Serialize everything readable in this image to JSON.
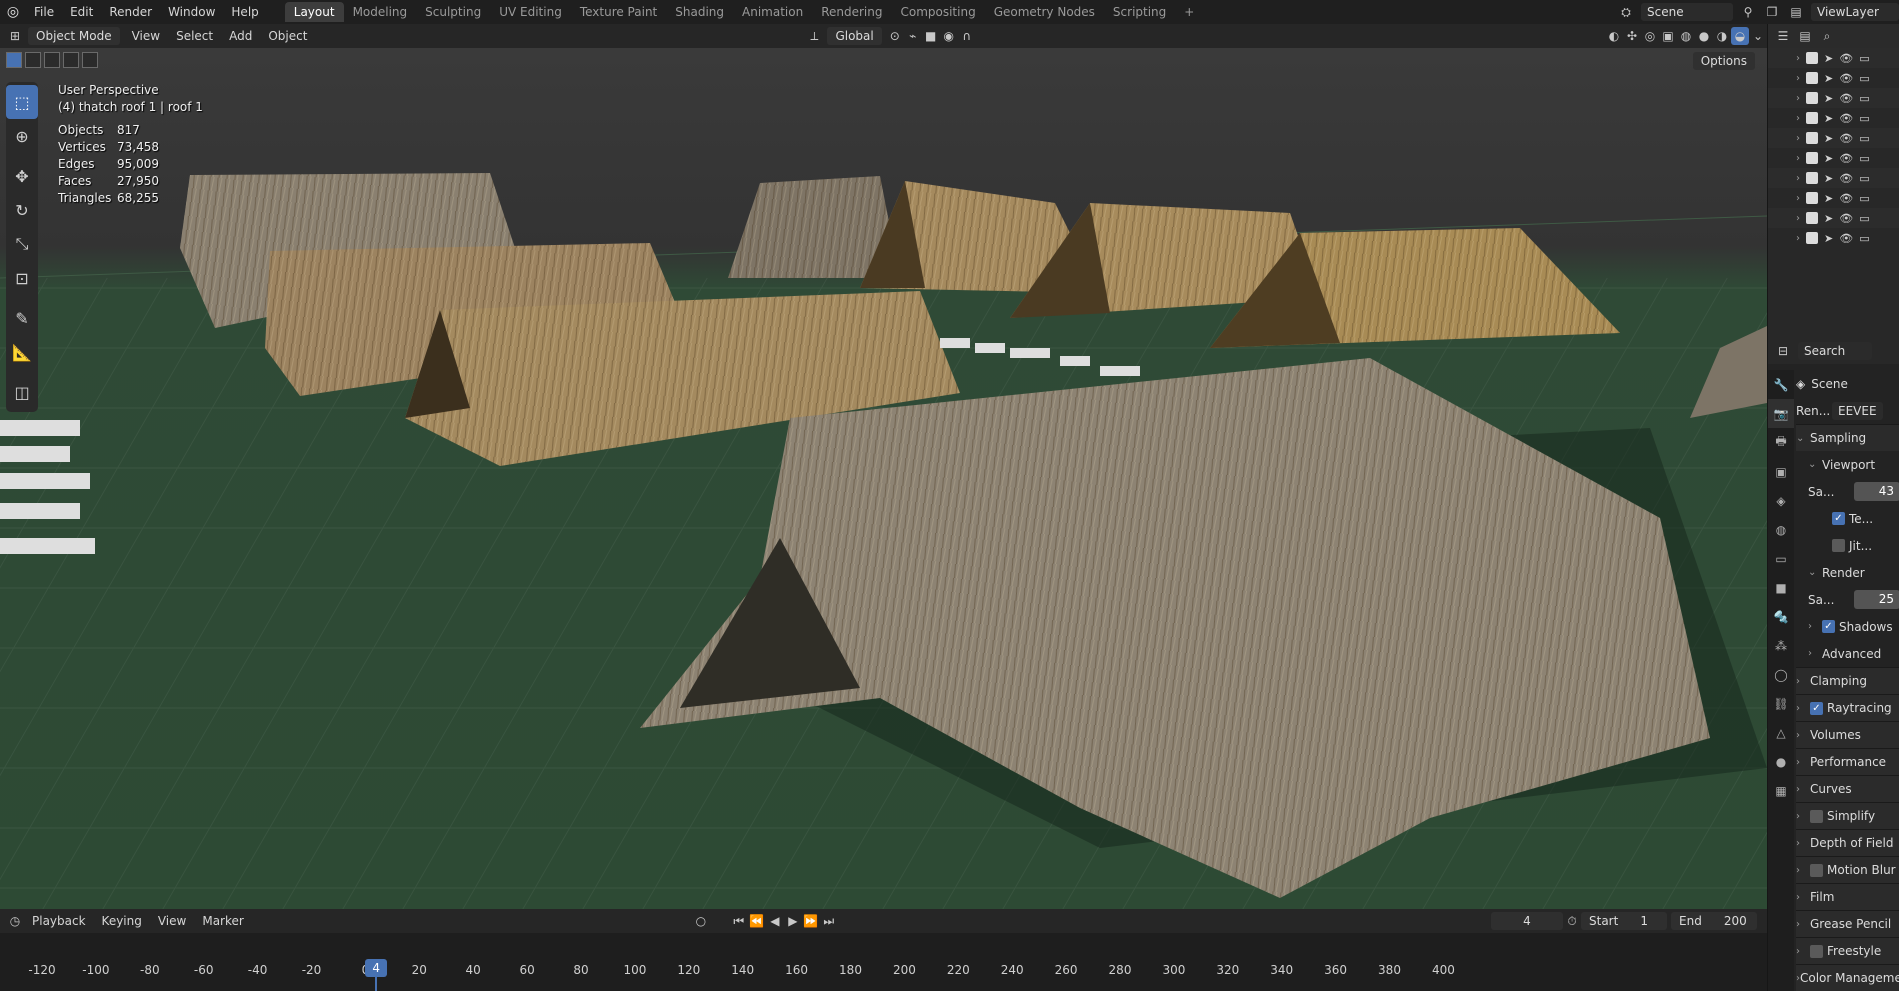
{
  "menu": {
    "items": [
      "File",
      "Edit",
      "Render",
      "Window",
      "Help"
    ],
    "workspaces": [
      "Layout",
      "Modeling",
      "Sculpting",
      "UV Editing",
      "Texture Paint",
      "Shading",
      "Animation",
      "Rendering",
      "Compositing",
      "Geometry Nodes",
      "Scripting"
    ],
    "active_workspace": "Layout",
    "add_tab": "+",
    "scene": "Scene",
    "view_layer": "ViewLayer"
  },
  "viewport_header": {
    "mode": "Object Mode",
    "menus": [
      "View",
      "Select",
      "Add",
      "Object"
    ],
    "orientation": "Global",
    "options": "Options"
  },
  "overlay": {
    "perspective": "User Perspective",
    "context": "(4) thatch roof 1 | roof 1",
    "stats": [
      {
        "label": "Objects",
        "value": "817"
      },
      {
        "label": "Vertices",
        "value": "73,458"
      },
      {
        "label": "Edges",
        "value": "95,009"
      },
      {
        "label": "Faces",
        "value": "27,950"
      },
      {
        "label": "Triangles",
        "value": "68,255"
      }
    ]
  },
  "toolbar": {
    "tools": [
      "select-box-tool",
      "cursor-tool",
      "move-tool",
      "rotate-tool",
      "scale-tool",
      "transform-tool",
      "annotate-tool",
      "measure-tool",
      "add-cube-tool"
    ]
  },
  "timeline": {
    "menus": [
      "Playback",
      "Keying",
      "View",
      "Marker"
    ],
    "current_frame": "4",
    "start_label": "Start",
    "start": "1",
    "end_label": "End",
    "end": "200",
    "ticks": [
      "-120",
      "-100",
      "-80",
      "-60",
      "-40",
      "-20",
      "0",
      "20",
      "40",
      "60",
      "80",
      "100",
      "120",
      "140",
      "160",
      "180",
      "200",
      "220",
      "240",
      "260",
      "280",
      "300",
      "320",
      "340",
      "360",
      "380",
      "400"
    ]
  },
  "properties": {
    "search_placeholder": "Search",
    "scene_label": "Scene",
    "render_engine_label": "Ren...",
    "render_engine": "EEVEE",
    "sampling": "Sampling",
    "viewport": "Viewport",
    "viewport_samples_label": "Sa...",
    "viewport_samples": "43",
    "temporal_reprojection": "Te...",
    "jitter": "Jit...",
    "render": "Render",
    "render_samples_label": "Sa...",
    "render_samples": "25",
    "shadows": "Shadows",
    "advanced": "Advanced",
    "clamping": "Clamping",
    "raytracing": "Raytracing",
    "volumes": "Volumes",
    "performance": "Performance",
    "curves": "Curves",
    "simplify": "Simplify",
    "depth_of_field": "Depth of Field",
    "motion_blur": "Motion Blur",
    "film": "Film",
    "grease_pencil": "Grease Pencil",
    "freestyle": "Freestyle",
    "color_management": "Color Management"
  },
  "colors": {
    "accent": "#4772b3",
    "ground": "#2d4a34",
    "thatch_light": "#b89b6a",
    "thatch_grey": "#8f8576"
  }
}
